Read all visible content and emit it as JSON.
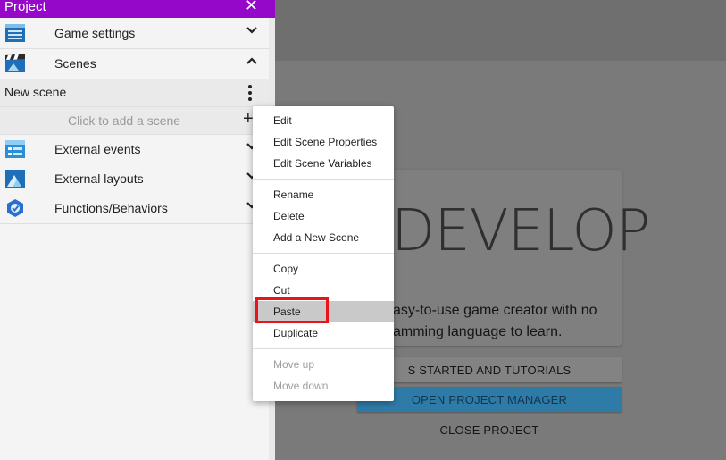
{
  "panel": {
    "title": "Project",
    "close_glyph": "✕",
    "sections": [
      {
        "label": "Game settings",
        "icon": "game-settings-icon",
        "chevron": "expand"
      },
      {
        "label": "Scenes",
        "icon": "scenes-icon",
        "chevron": "collapse"
      },
      {
        "label": "External events",
        "icon": "external-events-icon",
        "chevron": "expand"
      },
      {
        "label": "External layouts",
        "icon": "external-layouts-icon",
        "chevron": "expand"
      },
      {
        "label": "Functions/Behaviors",
        "icon": "functions-behaviors-icon",
        "chevron": "expand"
      }
    ],
    "scene_item": "New scene",
    "add_scene": "Click to add a scene",
    "add_glyph": "+",
    "accent": "#9508c9"
  },
  "context_menu": {
    "items": [
      {
        "label": "Edit",
        "enabled": true
      },
      {
        "label": "Edit Scene Properties",
        "enabled": true
      },
      {
        "label": "Edit Scene Variables",
        "enabled": true
      },
      {
        "label": "Rename",
        "enabled": true
      },
      {
        "label": "Delete",
        "enabled": true
      },
      {
        "label": "Add a New Scene",
        "enabled": true
      },
      {
        "label": "Copy",
        "enabled": true
      },
      {
        "label": "Cut",
        "enabled": true
      },
      {
        "label": "Paste",
        "enabled": true,
        "hovered": true
      },
      {
        "label": "Duplicate",
        "enabled": true
      },
      {
        "label": "Move up",
        "enabled": false
      },
      {
        "label": "Move down",
        "enabled": false
      }
    ],
    "highlight_color": "#e8131b"
  },
  "start_page": {
    "headline": "DEVELOP",
    "tagline_line1": "asy-to-use game creator with no",
    "tagline_line2": "amming language to learn.",
    "btn_tutorials": "S STARTED AND TUTORIALS",
    "btn_manager": "OPEN PROJECT MANAGER",
    "btn_close": "CLOSE PROJECT"
  }
}
